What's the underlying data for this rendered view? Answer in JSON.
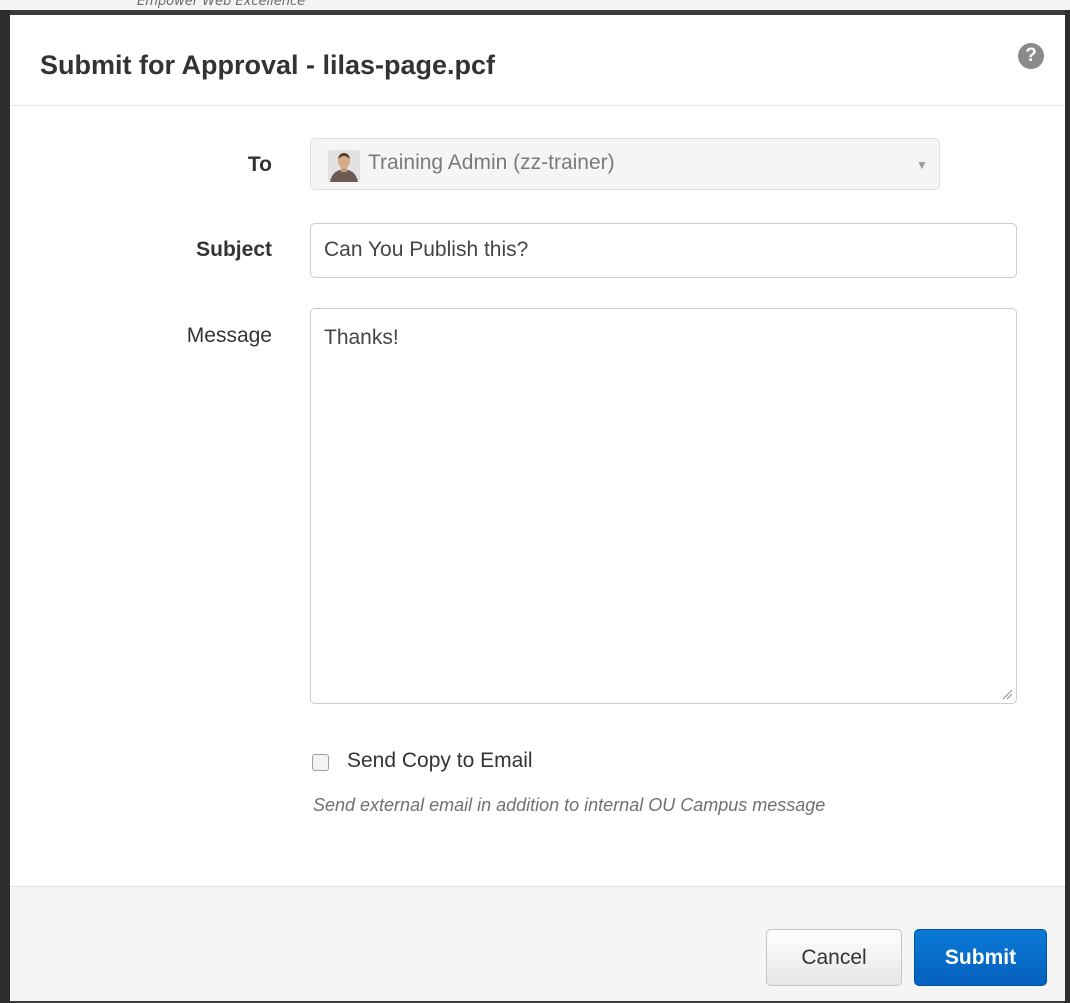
{
  "background": {
    "tagline": "Empower Web Excellence"
  },
  "dialog": {
    "title": "Submit for Approval - lilas-page.pcf",
    "help_icon": "question-circle-icon"
  },
  "form": {
    "to": {
      "label": "To",
      "value": "Training Admin (zz-trainer)",
      "avatar_icon": "user-avatar-icon"
    },
    "subject": {
      "label": "Subject",
      "value": "Can You Publish this?"
    },
    "message": {
      "label": "Message",
      "value": "Thanks!"
    },
    "send_copy": {
      "label": "Send Copy to Email",
      "checked": false,
      "help": "Send external email in addition to internal OU Campus message"
    }
  },
  "footer": {
    "cancel_label": "Cancel",
    "submit_label": "Submit"
  },
  "colors": {
    "primary": "#0561bd",
    "overlay": "#3b3b3b"
  }
}
